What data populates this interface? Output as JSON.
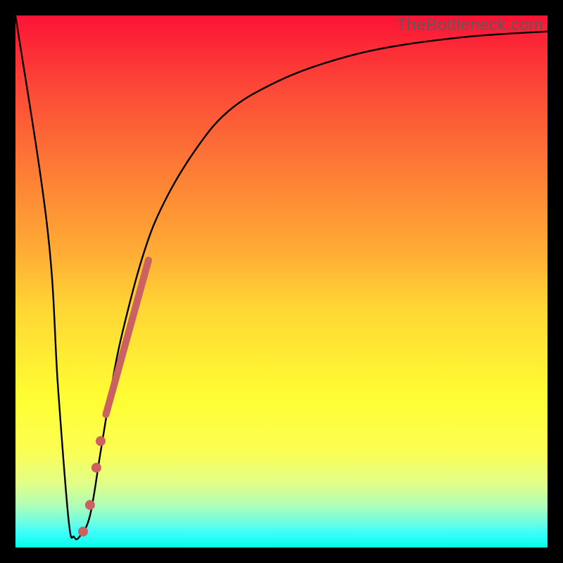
{
  "watermark": "TheBottleneck.com",
  "chart_data": {
    "type": "line",
    "title": "",
    "xlabel": "",
    "ylabel": "",
    "xlim": [
      0,
      100
    ],
    "ylim": [
      0,
      100
    ],
    "grid": false,
    "legend": false,
    "series": [
      {
        "name": "bottleneck-curve",
        "x": [
          0,
          6,
          8,
          10,
          11,
          12,
          14,
          16,
          18,
          20,
          24,
          28,
          34,
          40,
          48,
          58,
          70,
          85,
          100
        ],
        "y": [
          100,
          60,
          30,
          5,
          2,
          2,
          6,
          18,
          30,
          40,
          55,
          65,
          75,
          82,
          87,
          91,
          94,
          96,
          97
        ]
      }
    ],
    "markers": [
      {
        "name": "thick-segment",
        "path_x": [
          17,
          25
        ],
        "path_y": [
          25,
          54
        ],
        "stroke_width": 10,
        "color": "#cb6160"
      },
      {
        "name": "dot-1",
        "x": 16.0,
        "y": 20.0,
        "r": 7,
        "color": "#cb6160"
      },
      {
        "name": "dot-2",
        "x": 15.2,
        "y": 15.0,
        "r": 7,
        "color": "#cb6160"
      },
      {
        "name": "dot-3",
        "x": 14.0,
        "y": 8.0,
        "r": 7,
        "color": "#cb6160"
      },
      {
        "name": "dot-4",
        "x": 12.7,
        "y": 3.0,
        "r": 7,
        "color": "#cb6160"
      }
    ]
  }
}
